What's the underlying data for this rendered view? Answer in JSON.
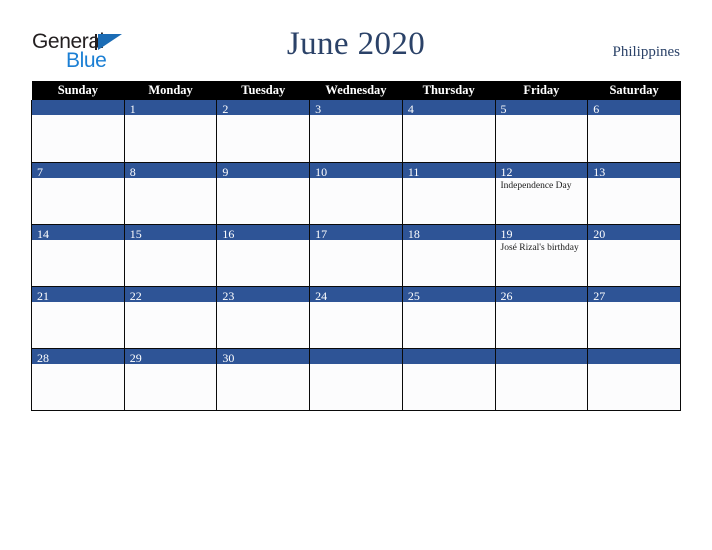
{
  "header": {
    "logo": {
      "word_top": "General",
      "word_bottom": "Blue",
      "triangle_icon": "logo-triangle-icon",
      "color_dark": "#231f20",
      "color_blue": "#1b7fd4"
    },
    "title": "June 2020",
    "country": "Philippines"
  },
  "calendar": {
    "accent_color": "#2e5496",
    "header_bg": "#000000",
    "weekdays": [
      "Sunday",
      "Monday",
      "Tuesday",
      "Wednesday",
      "Thursday",
      "Friday",
      "Saturday"
    ],
    "weeks": [
      [
        {
          "day": "",
          "events": []
        },
        {
          "day": "1",
          "events": []
        },
        {
          "day": "2",
          "events": []
        },
        {
          "day": "3",
          "events": []
        },
        {
          "day": "4",
          "events": []
        },
        {
          "day": "5",
          "events": []
        },
        {
          "day": "6",
          "events": []
        }
      ],
      [
        {
          "day": "7",
          "events": []
        },
        {
          "day": "8",
          "events": []
        },
        {
          "day": "9",
          "events": []
        },
        {
          "day": "10",
          "events": []
        },
        {
          "day": "11",
          "events": []
        },
        {
          "day": "12",
          "events": [
            "Independence Day"
          ]
        },
        {
          "day": "13",
          "events": []
        }
      ],
      [
        {
          "day": "14",
          "events": []
        },
        {
          "day": "15",
          "events": []
        },
        {
          "day": "16",
          "events": []
        },
        {
          "day": "17",
          "events": []
        },
        {
          "day": "18",
          "events": []
        },
        {
          "day": "19",
          "events": [
            "José Rizal's birthday"
          ]
        },
        {
          "day": "20",
          "events": []
        }
      ],
      [
        {
          "day": "21",
          "events": []
        },
        {
          "day": "22",
          "events": []
        },
        {
          "day": "23",
          "events": []
        },
        {
          "day": "24",
          "events": []
        },
        {
          "day": "25",
          "events": []
        },
        {
          "day": "26",
          "events": []
        },
        {
          "day": "27",
          "events": []
        }
      ],
      [
        {
          "day": "28",
          "events": []
        },
        {
          "day": "29",
          "events": []
        },
        {
          "day": "30",
          "events": []
        },
        {
          "day": "",
          "events": []
        },
        {
          "day": "",
          "events": []
        },
        {
          "day": "",
          "events": []
        },
        {
          "day": "",
          "events": []
        }
      ]
    ]
  }
}
